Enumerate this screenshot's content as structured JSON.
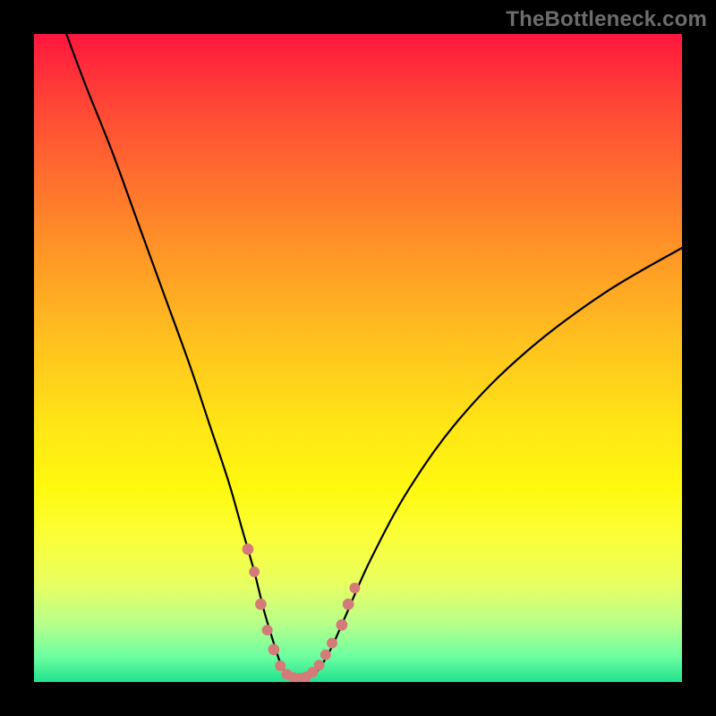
{
  "watermark": {
    "text": "TheBottleneck.com"
  },
  "colors": {
    "page_bg": "#000000",
    "curve": "#000000",
    "marker": "#d47a78",
    "gradient_top": "#ff163e",
    "gradient_bottom": "#20e28f"
  },
  "chart_data": {
    "type": "line",
    "title": "",
    "xlabel": "",
    "ylabel": "",
    "xlim": [
      0,
      100
    ],
    "ylim": [
      0,
      100
    ],
    "grid": false,
    "legend": false,
    "series": [
      {
        "name": "bottleneck-curve",
        "x": [
          5,
          8,
          12,
          16,
          20,
          24,
          27,
          30,
          32,
          34,
          35.5,
          37,
          38,
          39,
          40,
          41.5,
          43,
          44.5,
          46,
          48,
          52,
          58,
          66,
          76,
          88,
          100
        ],
        "y": [
          100,
          92,
          82,
          71,
          60,
          49,
          40,
          31,
          24,
          17,
          11,
          6,
          3,
          1.2,
          0.5,
          0.5,
          1.0,
          2.8,
          5.5,
          10,
          19,
          30,
          41,
          51,
          60,
          67
        ]
      }
    ],
    "markers": [
      {
        "x": 33.0,
        "y": 20.5,
        "r": 1.6
      },
      {
        "x": 34.0,
        "y": 17.0,
        "r": 1.5
      },
      {
        "x": 35.0,
        "y": 12.0,
        "r": 1.6
      },
      {
        "x": 36.0,
        "y": 8.0,
        "r": 1.5
      },
      {
        "x": 37.0,
        "y": 5.0,
        "r": 1.6
      },
      {
        "x": 38.0,
        "y": 2.5,
        "r": 1.5
      },
      {
        "x": 39.0,
        "y": 1.2,
        "r": 1.5
      },
      {
        "x": 40.0,
        "y": 0.7,
        "r": 1.5
      },
      {
        "x": 41.0,
        "y": 0.6,
        "r": 1.5
      },
      {
        "x": 42.0,
        "y": 0.8,
        "r": 1.5
      },
      {
        "x": 43.0,
        "y": 1.5,
        "r": 1.5
      },
      {
        "x": 44.0,
        "y": 2.6,
        "r": 1.5
      },
      {
        "x": 45.0,
        "y": 4.2,
        "r": 1.5
      },
      {
        "x": 46.0,
        "y": 6.0,
        "r": 1.5
      },
      {
        "x": 47.5,
        "y": 8.8,
        "r": 1.6
      },
      {
        "x": 48.5,
        "y": 12.0,
        "r": 1.6
      },
      {
        "x": 49.5,
        "y": 14.5,
        "r": 1.5
      }
    ]
  }
}
